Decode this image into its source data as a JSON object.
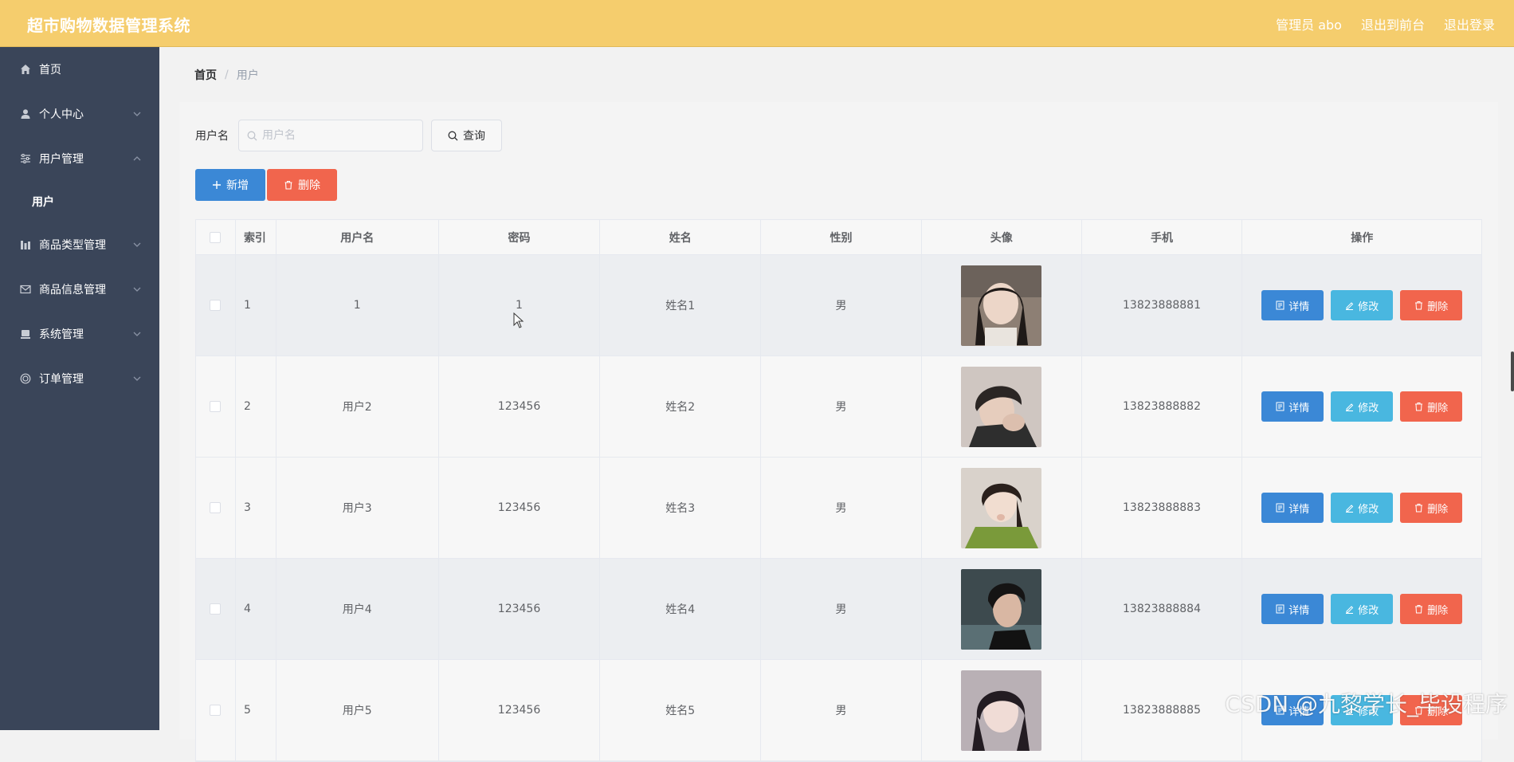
{
  "header": {
    "title": "超市购物数据管理系统",
    "admin_label": "管理员 abo",
    "back_to_front": "退出到前台",
    "logout": "退出登录"
  },
  "sidebar": {
    "items": [
      {
        "label": "首页",
        "icon": "home-icon"
      },
      {
        "label": "个人中心",
        "icon": "user-icon"
      },
      {
        "label": "用户管理",
        "icon": "sliders-icon"
      },
      {
        "label": "商品类型管理",
        "icon": "bar-chart-icon"
      },
      {
        "label": "商品信息管理",
        "icon": "mail-icon"
      },
      {
        "label": "系统管理",
        "icon": "monitor-icon"
      },
      {
        "label": "订单管理",
        "icon": "circle-icon"
      }
    ],
    "subitem": "用户"
  },
  "breadcrumb": {
    "home": "首页",
    "separator": "/",
    "current": "用户"
  },
  "search": {
    "label": "用户名",
    "placeholder": "用户名",
    "query_button": "查询"
  },
  "actions": {
    "add": "新增",
    "delete": "删除"
  },
  "table": {
    "headers": {
      "index": "索引",
      "username": "用户名",
      "password": "密码",
      "name": "姓名",
      "gender": "性别",
      "avatar": "头像",
      "phone": "手机",
      "ops": "操作"
    },
    "rows": [
      {
        "index": "1",
        "username": "1",
        "password": "1",
        "name": "姓名1",
        "gender": "男",
        "phone": "13823888881"
      },
      {
        "index": "2",
        "username": "用户2",
        "password": "123456",
        "name": "姓名2",
        "gender": "男",
        "phone": "13823888882"
      },
      {
        "index": "3",
        "username": "用户3",
        "password": "123456",
        "name": "姓名3",
        "gender": "男",
        "phone": "13823888883"
      },
      {
        "index": "4",
        "username": "用户4",
        "password": "123456",
        "name": "姓名4",
        "gender": "男",
        "phone": "13823888884"
      },
      {
        "index": "5",
        "username": "用户5",
        "password": "123456",
        "name": "姓名5",
        "gender": "男",
        "phone": "13823888885"
      }
    ],
    "op_labels": {
      "detail": "详情",
      "edit": "修改",
      "delete": "删除"
    }
  },
  "watermark": "CSDN @九黎学长_毕设程序",
  "colors": {
    "header": "#f5cd6d",
    "sidebar": "#3a4559",
    "primary": "#3b88d6",
    "info": "#49b7e0",
    "danger": "#f1654d"
  }
}
